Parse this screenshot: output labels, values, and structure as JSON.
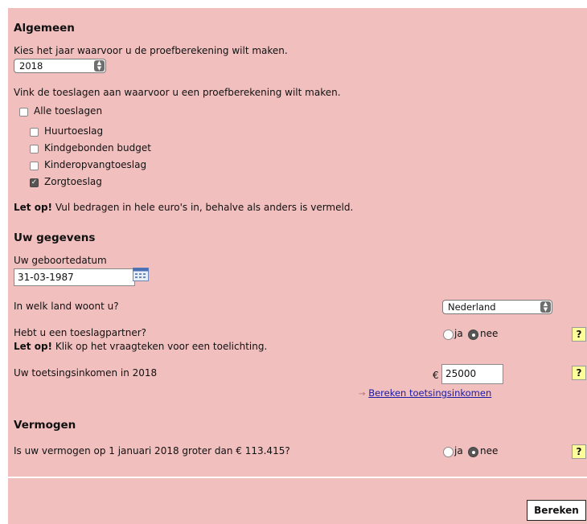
{
  "algemeen": {
    "heading": "Algemeen",
    "year_prompt": "Kies het jaar waarvoor u de proefberekening wilt maken.",
    "year_value": "2018",
    "toeslagen_prompt": "Vink de toeslagen aan waarvoor u een proefberekening wilt maken.",
    "all_label": "Alle toeslagen",
    "items": [
      {
        "label": "Huurtoeslag",
        "checked": false
      },
      {
        "label": "Kindgebonden budget",
        "checked": false
      },
      {
        "label": "Kinderopvangtoeslag",
        "checked": false
      },
      {
        "label": "Zorgtoeslag",
        "checked": true
      }
    ],
    "note_bold": "Let op!",
    "note_text": " Vul bedragen in hele euro's in, behalve als anders is vermeld."
  },
  "gegevens": {
    "heading": "Uw gegevens",
    "birthdate_label": "Uw geboortedatum",
    "birthdate_value": "31-03-1987",
    "country_question": "In welk land woont u?",
    "country_value": "Nederland",
    "partner_question": "Hebt u een toeslagpartner?",
    "partner_note_bold": "Let op!",
    "partner_note_text": " Klik op het vraagteken voor een toelichting.",
    "yes_label": "ja",
    "no_label": "nee",
    "partner_answer": "nee",
    "income_label": "Uw toetsingsinkomen in 2018",
    "currency": "€",
    "income_value": "25000",
    "income_link": "Bereken toetsingsinkomen",
    "link_arrow": "→",
    "help": "?"
  },
  "vermogen": {
    "heading": "Vermogen",
    "question": "Is uw vermogen op 1 januari 2018 groter dan € 113.415?",
    "yes_label": "ja",
    "no_label": "nee",
    "answer": "nee"
  },
  "submit_label": "Bereken",
  "colors": {
    "background": "#f2bfbf",
    "help_bg": "#ffff99",
    "link": "#1a1aa6"
  },
  "icons": {
    "calendar": "calendar-icon",
    "select_arrows": "chevron-updown-icon"
  }
}
